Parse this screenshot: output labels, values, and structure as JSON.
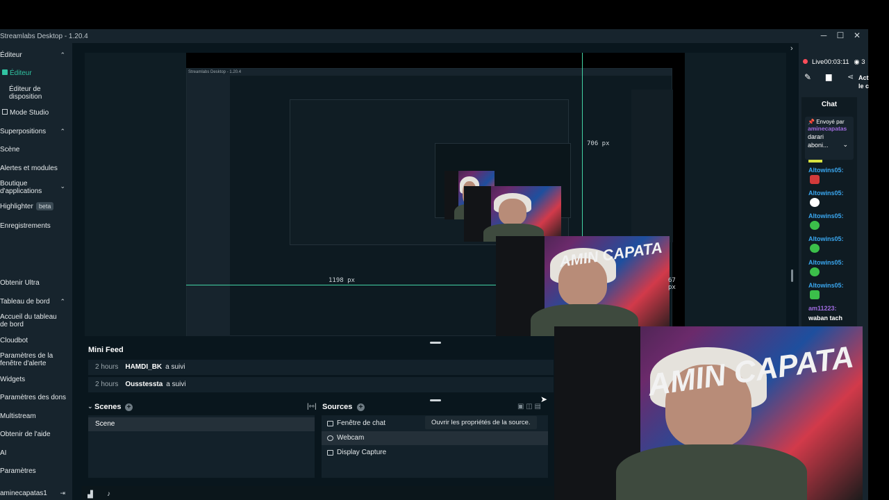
{
  "window": {
    "title": "Streamlabs Desktop - 1.20.4",
    "controls": [
      "─",
      "☐",
      "✕"
    ]
  },
  "sidebar": {
    "items": [
      {
        "label": "Éditeur",
        "chev": "⌃"
      },
      {
        "label": "Éditeur"
      },
      {
        "label": "Éditeur de disposition"
      },
      {
        "label": "Mode Studio"
      },
      {
        "label": "Superpositions",
        "chev": "⌃"
      },
      {
        "label": "Scène"
      },
      {
        "label": "Alertes et modules"
      },
      {
        "label": "Boutique d'applications",
        "chev": "⌄"
      },
      {
        "label": "Highlighter",
        "badge": "beta"
      },
      {
        "label": "Enregistrements"
      },
      {
        "label": "Obtenir Ultra"
      },
      {
        "label": "Tableau de bord",
        "chev": "⌃"
      },
      {
        "label": "Accueil du tableau de bord"
      },
      {
        "label": "Cloudbot"
      },
      {
        "label": "Paramètres de la fenêtre d'alerte"
      },
      {
        "label": "Widgets"
      },
      {
        "label": "Paramètres des dons"
      },
      {
        "label": "Multistream"
      },
      {
        "label": "Obtenir de l'aide"
      },
      {
        "label": "AI"
      },
      {
        "label": "Paramètres"
      },
      {
        "label": "aminecapatas1"
      }
    ]
  },
  "preview": {
    "measure_v": "706 px",
    "measure_h": "1198 px",
    "measure_r": "67 px",
    "graffiti": "AMIN CAPATA"
  },
  "mini_feed": {
    "title": "Mini Feed",
    "rows": [
      {
        "time": "2 hours",
        "user": "HAMDI_BK",
        "action": "a suivi"
      },
      {
        "time": "2 hours",
        "user": "Ousstessta",
        "action": "a suivi"
      }
    ]
  },
  "scenes": {
    "title": "Scenes",
    "items": [
      "Scene"
    ]
  },
  "sources": {
    "title": "Sources",
    "items": [
      "Fenêtre de chat",
      "Webcam",
      "Display Capture"
    ],
    "tooltip": "Ouvrir les propriétés de la source."
  },
  "live": {
    "label": "Live",
    "time": "00:03:11",
    "viewers": "3",
    "actions": "Act",
    "actions2": "le c"
  },
  "chat": {
    "tab": "Chat",
    "pinned_by": "Envoyé par",
    "pinned_user": "aminecapatas",
    "pinned_msg": "darari aboni...",
    "lines": [
      {
        "user": "Altowins05:"
      },
      {
        "user": "Altowins05:"
      },
      {
        "user": "Altowins05:"
      },
      {
        "user": "Altowins05:"
      },
      {
        "user": "Altowins05:"
      },
      {
        "user": "Altowins05:"
      },
      {
        "user": "am11223:",
        "msg": "waban tach"
      }
    ]
  },
  "colors": {
    "accent": "#31c3a2",
    "live_red": "#ff4d5a",
    "chat_user": "#3aa7f0",
    "pinned_user": "#a06be0"
  },
  "bigcam": {
    "graffiti": "AMIN CAPATA"
  }
}
